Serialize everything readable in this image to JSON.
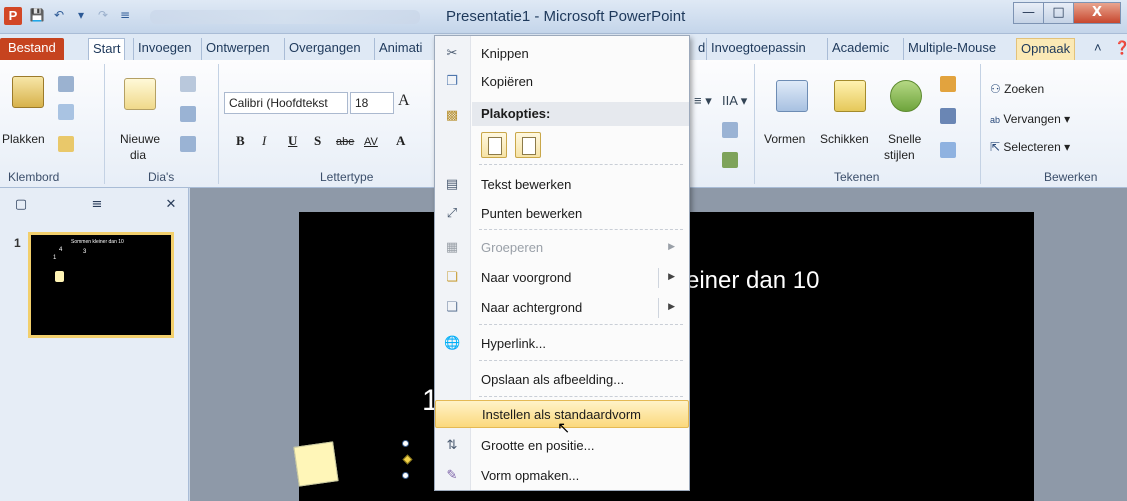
{
  "window": {
    "title": "Presentatie1 - Microsoft PowerPoint",
    "app_icon": "P",
    "controls": [
      "minimize-icon",
      "maximize-icon",
      "close-icon"
    ]
  },
  "ribbon_tabs": [
    "Bestand",
    "Start",
    "Invoegen",
    "Ontwerpen",
    "Overgangen",
    "Animati",
    "d",
    "Invoegtoepassin",
    "Academic",
    "Multiple-Mouse",
    "Opmaak"
  ],
  "active_tab": "Start",
  "ribbon": {
    "clipboard": {
      "paste": "Plakken",
      "group": "Klembord"
    },
    "slides": {
      "new_slide_line1": "Nieuwe",
      "new_slide_line2": "dia",
      "group": "Dia's"
    },
    "font": {
      "family": "Calibri (Hoofdtekst",
      "size": "18",
      "bold": "B",
      "italic": "I",
      "underline": "U",
      "shadow": "S",
      "strike": "abe",
      "spacing": "AV",
      "group": "Lettertype"
    },
    "drawing": {
      "shapes": "Vormen",
      "arrange": "Schikken",
      "quick_styles_line1": "Snelle",
      "quick_styles_line2": "stijlen",
      "group": "Tekenen"
    },
    "editing": {
      "find": "Zoeken",
      "replace": "Vervangen",
      "select": "Selecteren",
      "group": "Bewerken"
    }
  },
  "slide_panel": {
    "thumbnail_number": "1",
    "thumbnail_title": "Sommen kleiner dan 10",
    "thumbnail_nums": [
      "4",
      "3",
      "1"
    ]
  },
  "slide": {
    "title_visible": "einer dan 10",
    "number_visible": "1"
  },
  "context_menu": {
    "items": [
      {
        "label": "Knippen",
        "icon": "scissors-icon",
        "disabled": false
      },
      {
        "label": "Kopiëren",
        "icon": "copy-icon",
        "disabled": false
      },
      {
        "header": "Plakopties:",
        "icon": "paste-icon"
      },
      {
        "label": "Tekst bewerken",
        "icon": "edit-text-icon",
        "disabled": false
      },
      {
        "label": "Punten bewerken",
        "icon": "edit-points-icon",
        "disabled": false
      },
      {
        "label": "Groeperen",
        "icon": "group-icon",
        "disabled": true
      },
      {
        "label": "Naar voorgrond",
        "icon": "bring-front-icon",
        "disabled": false
      },
      {
        "label": "Naar achtergrond",
        "icon": "send-back-icon",
        "disabled": false
      },
      {
        "label": "Hyperlink...",
        "icon": "hyperlink-icon",
        "disabled": false
      },
      {
        "label": "Opslaan als afbeelding...",
        "icon": "",
        "disabled": false
      },
      {
        "label": "Instellen als standaardvorm",
        "icon": "",
        "disabled": false,
        "highlighted": true
      },
      {
        "label": "Grootte en positie...",
        "icon": "size-position-icon",
        "disabled": false
      },
      {
        "label": "Vorm opmaken...",
        "icon": "format-shape-icon",
        "disabled": false
      }
    ]
  }
}
